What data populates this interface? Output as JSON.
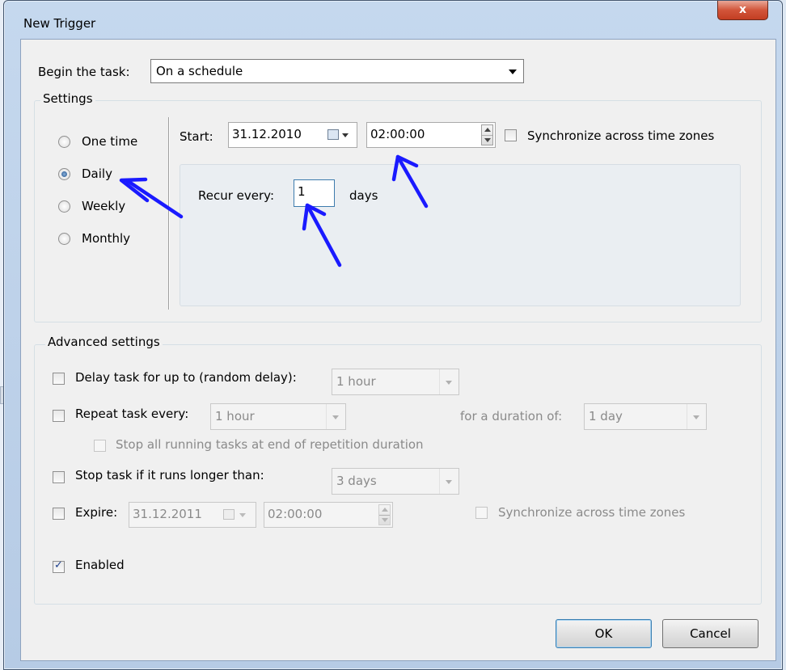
{
  "window": {
    "title": "New Trigger",
    "close_glyph": "x"
  },
  "begin": {
    "label": "Begin the task:",
    "value": "On a schedule"
  },
  "settings": {
    "group_title": "Settings",
    "radios": [
      {
        "label": "One time",
        "selected": false
      },
      {
        "label": "Daily",
        "selected": true
      },
      {
        "label": "Weekly",
        "selected": false
      },
      {
        "label": "Monthly",
        "selected": false
      }
    ],
    "start_label": "Start:",
    "start_date": "31.12.2010",
    "start_time": "02:00:00",
    "sync_label": "Synchronize across time zones",
    "recur_label": "Recur every:",
    "recur_value": "1",
    "recur_unit": "days"
  },
  "advanced": {
    "group_title": "Advanced settings",
    "delay_label": "Delay task for up to (random delay):",
    "delay_value": "1 hour",
    "repeat_label": "Repeat task every:",
    "repeat_value": "1 hour",
    "duration_label": "for a duration of:",
    "duration_value": "1 day",
    "stop_all_label": "Stop all running tasks at end of repetition duration",
    "stop_longer_label": "Stop task if it runs longer than:",
    "stop_longer_value": "3 days",
    "expire_label": "Expire:",
    "expire_date": "31.12.2011",
    "expire_time": "02:00:00",
    "expire_sync_label": "Synchronize across time zones",
    "enabled_label": "Enabled",
    "enabled_checked": true
  },
  "buttons": {
    "ok": "OK",
    "cancel": "Cancel"
  },
  "annotation_color": "#1a1aff"
}
